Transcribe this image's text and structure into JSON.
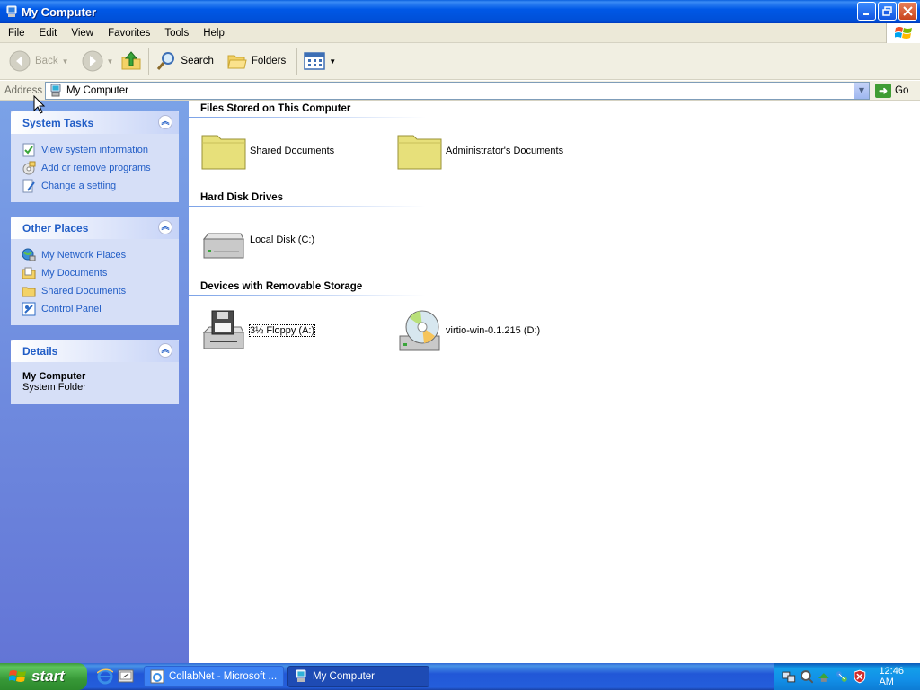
{
  "window": {
    "title": "My Computer"
  },
  "menu": [
    "File",
    "Edit",
    "View",
    "Favorites",
    "Tools",
    "Help"
  ],
  "toolbar": {
    "back": "Back",
    "search": "Search",
    "folders": "Folders"
  },
  "address": {
    "label": "Address",
    "value": "My Computer",
    "go": "Go"
  },
  "panels": {
    "system_tasks": {
      "title": "System Tasks",
      "items": [
        "View system information",
        "Add or remove programs",
        "Change a setting"
      ]
    },
    "other_places": {
      "title": "Other Places",
      "items": [
        "My Network Places",
        "My Documents",
        "Shared Documents",
        "Control Panel"
      ]
    },
    "details": {
      "title": "Details",
      "name": "My Computer",
      "type": "System Folder"
    }
  },
  "groups": [
    {
      "title": "Files Stored on This Computer",
      "items": [
        "Shared Documents",
        "Administrator's Documents"
      ]
    },
    {
      "title": "Hard Disk Drives",
      "items": [
        "Local Disk (C:)"
      ]
    },
    {
      "title": "Devices with Removable Storage",
      "items": [
        "3½ Floppy (A:)",
        "virtio-win-0.1.215 (D:)"
      ]
    }
  ],
  "taskbar": {
    "start": "start",
    "tasks": [
      "CollabNet - Microsoft ...",
      "My Computer"
    ],
    "clock": "12:46 AM"
  }
}
